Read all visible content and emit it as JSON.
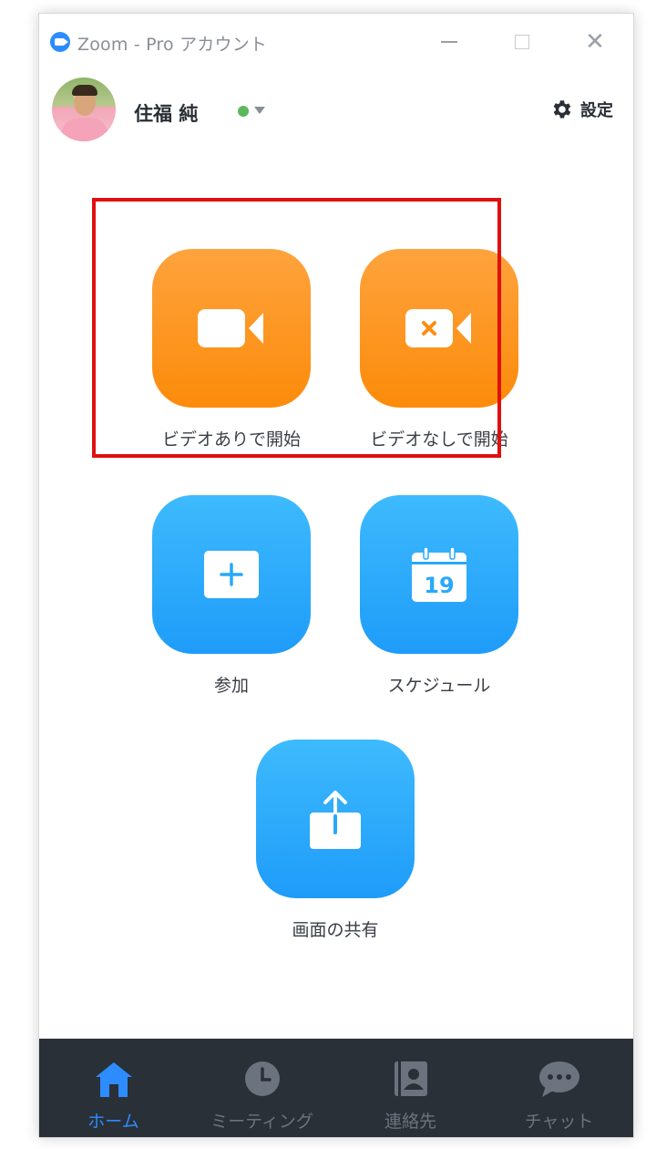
{
  "window": {
    "title": "Zoom - Pro アカウント",
    "close_glyph": "✕"
  },
  "header": {
    "user_name": "住福 純",
    "status_color": "#5cb85c",
    "settings_label": "設定"
  },
  "home": {
    "tiles": [
      {
        "label": "ビデオありで開始",
        "icon": "video-camera-icon",
        "color": "#fd9a25"
      },
      {
        "label": "ビデオなしで開始",
        "icon": "video-off-icon",
        "color": "#fd9a25"
      },
      {
        "label": "参加",
        "icon": "plus-icon",
        "color": "#2aaafb"
      },
      {
        "label": "スケジュール",
        "icon": "calendar-icon",
        "color": "#2aaafb",
        "calendar_day": "19"
      },
      {
        "label": "画面の共有",
        "icon": "share-screen-icon",
        "color": "#2aaafb"
      }
    ],
    "highlight_color": "#e01010"
  },
  "nav": {
    "items": [
      {
        "label": "ホーム",
        "icon": "home-icon",
        "active": true
      },
      {
        "label": "ミーティング",
        "icon": "clock-icon",
        "active": false
      },
      {
        "label": "連絡先",
        "icon": "contacts-icon",
        "active": false
      },
      {
        "label": "チャット",
        "icon": "chat-icon",
        "active": false
      }
    ],
    "active_color": "#2d8cff",
    "background": "#2a3038"
  }
}
